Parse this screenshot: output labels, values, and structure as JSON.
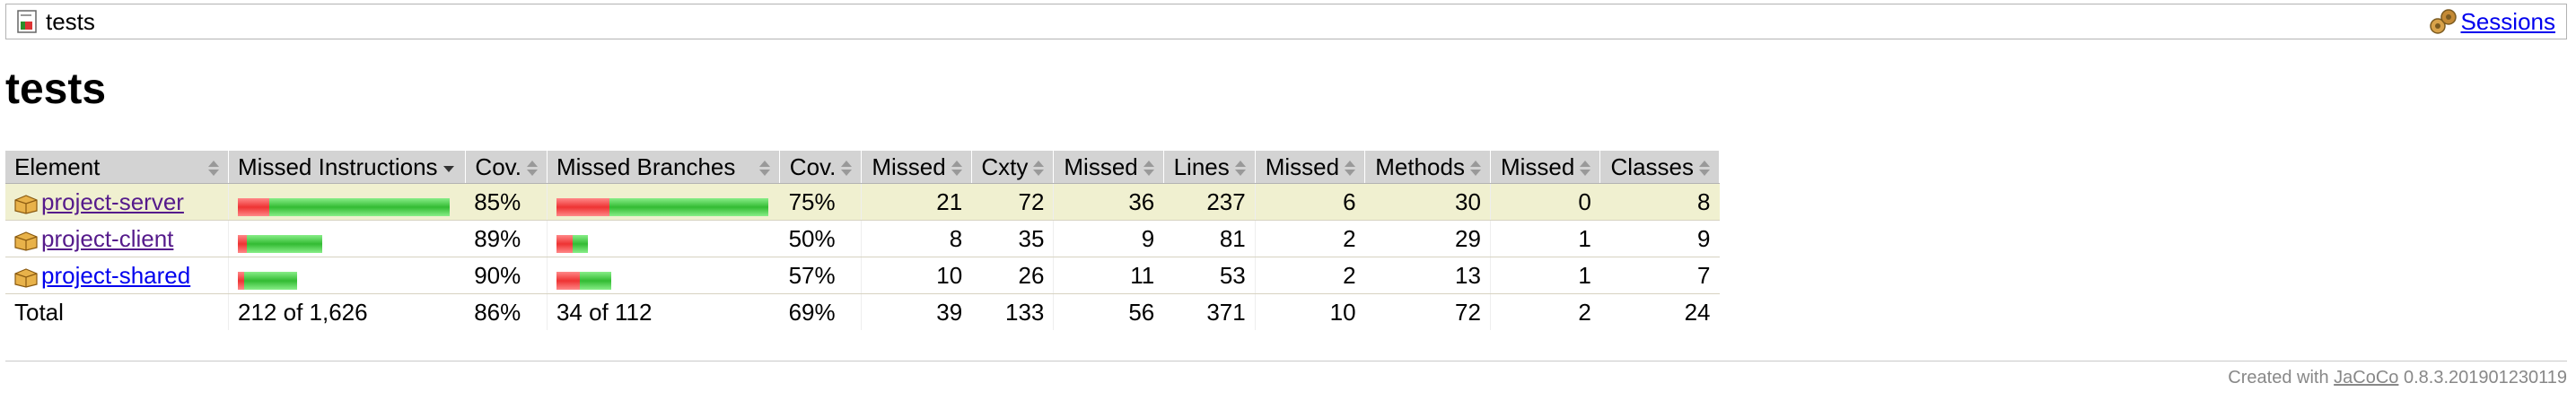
{
  "breadcrumb": {
    "title": "tests",
    "sessions_label": "Sessions"
  },
  "page_title": "tests",
  "table": {
    "headers": {
      "element": "Element",
      "missed_instructions": "Missed Instructions",
      "cov1": "Cov.",
      "missed_branches": "Missed Branches",
      "cov2": "Cov.",
      "missed_cxty": "Missed",
      "cxty": "Cxty",
      "missed_lines": "Missed",
      "lines": "Lines",
      "missed_methods": "Missed",
      "methods": "Methods",
      "missed_classes": "Missed",
      "classes": "Classes"
    },
    "rows": [
      {
        "name": "project-server",
        "instr_missed_frac": 0.15,
        "instr_scale": 1.0,
        "cov1": "85%",
        "branch_missed_frac": 0.25,
        "branch_scale": 1.0,
        "cov2": "75%",
        "missed_cxty": "21",
        "cxty": "72",
        "missed_lines": "36",
        "lines": "237",
        "missed_methods": "6",
        "methods": "30",
        "missed_classes": "0",
        "classes": "8"
      },
      {
        "name": "project-client",
        "instr_missed_frac": 0.11,
        "instr_scale": 0.4,
        "cov1": "89%",
        "branch_missed_frac": 0.5,
        "branch_scale": 0.15,
        "cov2": "50%",
        "missed_cxty": "8",
        "cxty": "35",
        "missed_lines": "9",
        "lines": "81",
        "missed_methods": "2",
        "methods": "29",
        "missed_classes": "1",
        "classes": "9"
      },
      {
        "name": "project-shared",
        "instr_missed_frac": 0.1,
        "instr_scale": 0.28,
        "cov1": "90%",
        "branch_missed_frac": 0.43,
        "branch_scale": 0.26,
        "cov2": "57%",
        "missed_cxty": "10",
        "cxty": "26",
        "missed_lines": "11",
        "lines": "53",
        "missed_methods": "2",
        "methods": "13",
        "missed_classes": "1",
        "classes": "7"
      }
    ],
    "total": {
      "label": "Total",
      "instr": "212 of 1,626",
      "cov1": "86%",
      "branches": "34 of 112",
      "cov2": "69%",
      "missed_cxty": "39",
      "cxty": "133",
      "missed_lines": "56",
      "lines": "371",
      "missed_methods": "10",
      "methods": "72",
      "missed_classes": "2",
      "classes": "24"
    }
  },
  "footer": {
    "prefix": "Created with",
    "link": "JaCoCo",
    "version": "0.8.3.201901230119"
  },
  "colors": {
    "bar_red": "#e33333",
    "bar_green": "#33bb33",
    "header_bg": "#d3d3d3",
    "selected_row": "#f0f0d0",
    "link": "#0000ee"
  }
}
